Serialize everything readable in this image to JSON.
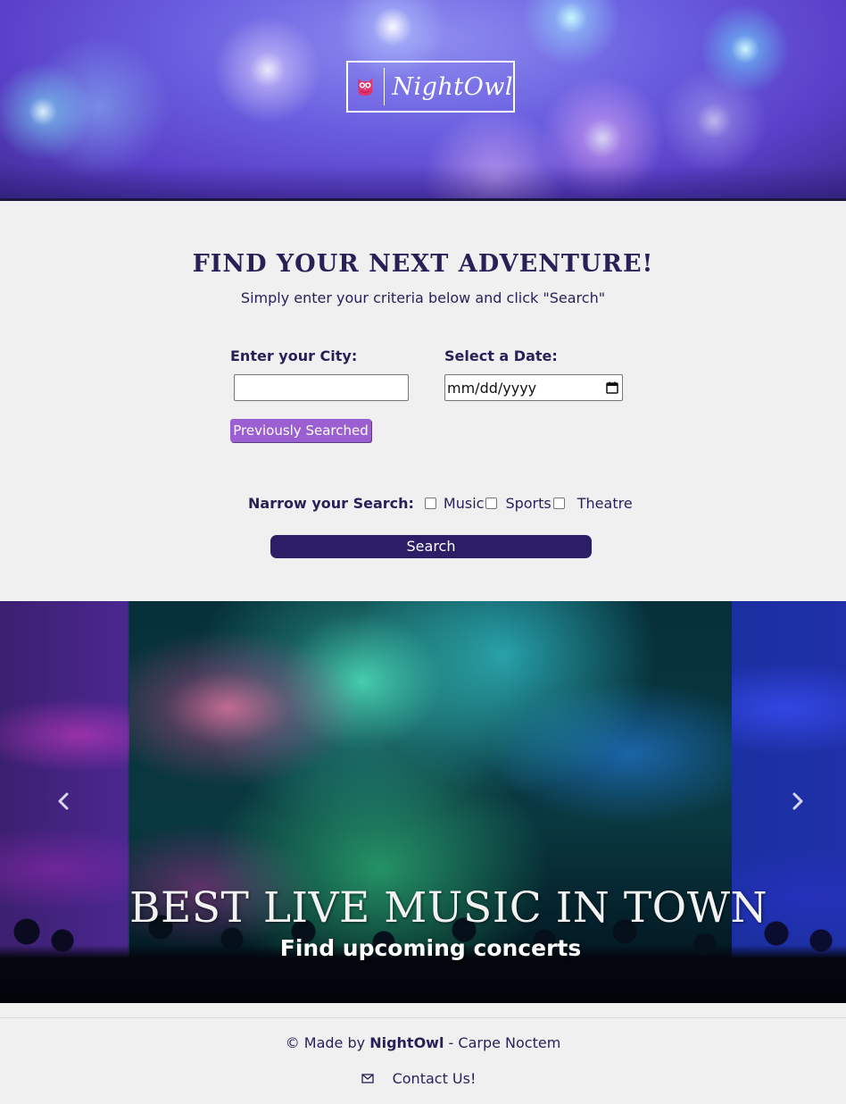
{
  "header": {
    "logo_text": "NightOwl"
  },
  "search": {
    "title": "FIND YOUR NEXT ADVENTURE!",
    "subtitle": "Simply enter your criteria below and click \"Search\"",
    "city_label": "Enter your City:",
    "city_value": "",
    "date_label": "Select a Date:",
    "date_placeholder": "mm/dd/yyyy",
    "previous_button": "Previously Searched",
    "narrow_label": "Narrow your Search:",
    "categories": [
      {
        "label": "Music",
        "checked": false
      },
      {
        "label": "Sports",
        "checked": false
      },
      {
        "label": "Theatre",
        "checked": false
      }
    ],
    "search_button": "Search"
  },
  "carousel": {
    "title": "BEST LIVE MUSIC IN TOWN",
    "caption": "Find upcoming concerts"
  },
  "footer": {
    "credit_prefix": "© Made by",
    "brand": "NightOwl",
    "credit_suffix": "- Carpe Noctem",
    "contact": "Contact Us!"
  },
  "colors": {
    "primary": "#2c1e66",
    "accent": "#9b5fd1",
    "logo_owl": "#e0336f",
    "text": "#2a1f57"
  }
}
